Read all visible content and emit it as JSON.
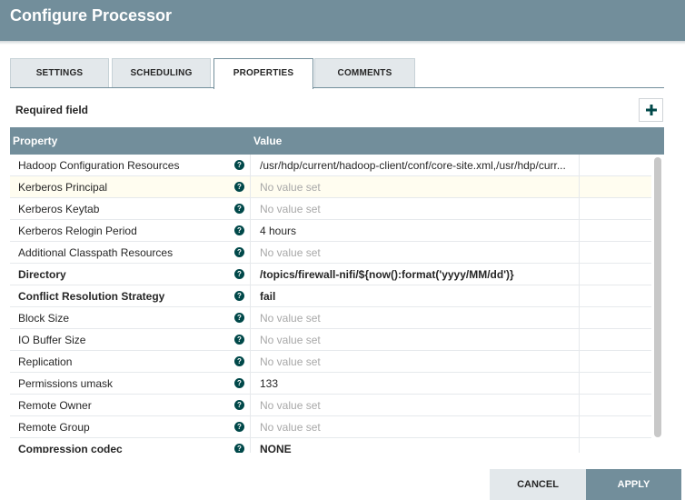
{
  "dialog": {
    "title": "Configure Processor"
  },
  "tabs": [
    {
      "label": "SETTINGS",
      "active": false
    },
    {
      "label": "SCHEDULING",
      "active": false
    },
    {
      "label": "PROPERTIES",
      "active": true
    },
    {
      "label": "COMMENTS",
      "active": false
    }
  ],
  "properties_tab": {
    "required_label": "Required field",
    "add_button_icon": "plus-icon",
    "columns": {
      "property": "Property",
      "value": "Value"
    },
    "rows": [
      {
        "name": "Hadoop Configuration Resources",
        "required": false,
        "value": "/usr/hdp/current/hadoop-client/conf/core-site.xml,/usr/hdp/curr...",
        "unset": false,
        "selected": false
      },
      {
        "name": "Kerberos Principal",
        "required": false,
        "value": "No value set",
        "unset": true,
        "selected": true
      },
      {
        "name": "Kerberos Keytab",
        "required": false,
        "value": "No value set",
        "unset": true,
        "selected": false
      },
      {
        "name": "Kerberos Relogin Period",
        "required": false,
        "value": "4 hours",
        "unset": false,
        "selected": false
      },
      {
        "name": "Additional Classpath Resources",
        "required": false,
        "value": "No value set",
        "unset": true,
        "selected": false
      },
      {
        "name": "Directory",
        "required": true,
        "value": "/topics/firewall-nifi/${now():format('yyyy/MM/dd')}",
        "unset": false,
        "selected": false
      },
      {
        "name": "Conflict Resolution Strategy",
        "required": true,
        "value": "fail",
        "unset": false,
        "selected": false
      },
      {
        "name": "Block Size",
        "required": false,
        "value": "No value set",
        "unset": true,
        "selected": false
      },
      {
        "name": "IO Buffer Size",
        "required": false,
        "value": "No value set",
        "unset": true,
        "selected": false
      },
      {
        "name": "Replication",
        "required": false,
        "value": "No value set",
        "unset": true,
        "selected": false
      },
      {
        "name": "Permissions umask",
        "required": false,
        "value": "133",
        "unset": false,
        "selected": false
      },
      {
        "name": "Remote Owner",
        "required": false,
        "value": "No value set",
        "unset": true,
        "selected": false
      },
      {
        "name": "Remote Group",
        "required": false,
        "value": "No value set",
        "unset": true,
        "selected": false
      },
      {
        "name": "Compression codec",
        "required": true,
        "value": "NONE",
        "unset": false,
        "selected": false
      }
    ],
    "help_icon": "question-circle-icon"
  },
  "footer": {
    "cancel_label": "CANCEL",
    "apply_label": "APPLY"
  },
  "colors": {
    "header": "#728e9b",
    "help_icon": "#004849",
    "selected_row": "#fffdf0"
  }
}
